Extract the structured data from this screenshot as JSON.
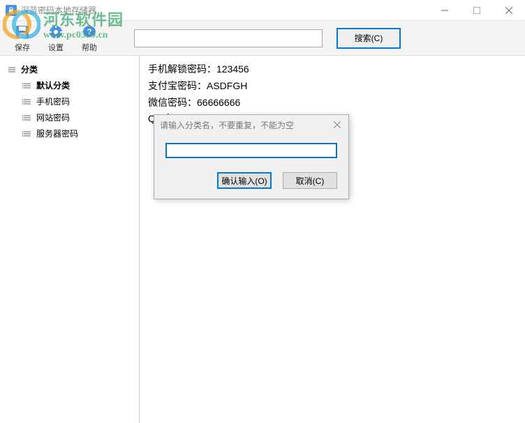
{
  "window": {
    "title": "深蓝密码本地存储器"
  },
  "toolbar": {
    "save": "保存",
    "settings": "设置",
    "help": "帮助"
  },
  "search": {
    "value": "",
    "button": "搜索(C)"
  },
  "tree": {
    "root": "分类",
    "items": [
      {
        "label": "默认分类",
        "selected": true
      },
      {
        "label": "手机密码",
        "selected": false
      },
      {
        "label": "网站密码",
        "selected": false
      },
      {
        "label": "服务器密码",
        "selected": false
      }
    ]
  },
  "content": {
    "lines": [
      "手机解锁密码：123456",
      "支付宝密码：ASDFGH",
      "微信密码：66666666",
      "QQ密"
    ]
  },
  "dialog": {
    "title": "请输入分类名，不要重复，不能为空",
    "input_value": "",
    "confirm": "确认输入(O)",
    "cancel": "取消(C)"
  },
  "watermark": {
    "title": "河东软件园",
    "url": "www.pc0359.cn"
  }
}
